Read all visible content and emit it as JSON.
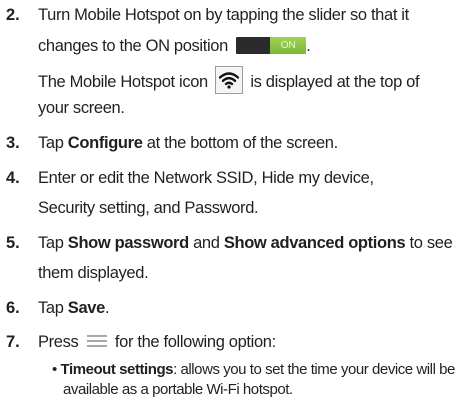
{
  "steps": [
    {
      "number": "2.",
      "line1": "Turn Mobile Hotspot on by tapping the slider so that it",
      "line2_before": "changes to the ON position",
      "line2_after": ".",
      "line3_before": "The Mobile Hotspot icon",
      "line3_after": "is displayed at the top of",
      "line4": "your screen."
    },
    {
      "number": "3.",
      "before": "Tap ",
      "bold": "Configure",
      "after": " at the bottom of the screen."
    },
    {
      "number": "4.",
      "line1": "Enter or edit the Network SSID, Hide my device,",
      "line2": "Security setting, and Password."
    },
    {
      "number": "5.",
      "before": "Tap ",
      "bold1": "Show password",
      "middle": " and ",
      "bold2": "Show advanced options",
      "after": " to see",
      "line2": "them displayed."
    },
    {
      "number": "6.",
      "before": "Tap ",
      "bold": "Save",
      "after": "."
    },
    {
      "number": "7.",
      "before": "Press",
      "after": "for the following option:"
    }
  ],
  "bullet": {
    "symbol": "•",
    "bold": "Timeout settings",
    "after": ": allows you to set the time your device will be",
    "line2": "available as a portable Wi-Fi hotspot."
  },
  "toggle_label": "ON",
  "icons": {
    "toggle": "on-off-toggle-icon",
    "hotspot": "wifi-hotspot-icon",
    "menu": "menu-key-icon"
  },
  "colors": {
    "text": "#231f20",
    "toggle_on": "#8bc34a",
    "toggle_track": "#2b2b2b"
  }
}
